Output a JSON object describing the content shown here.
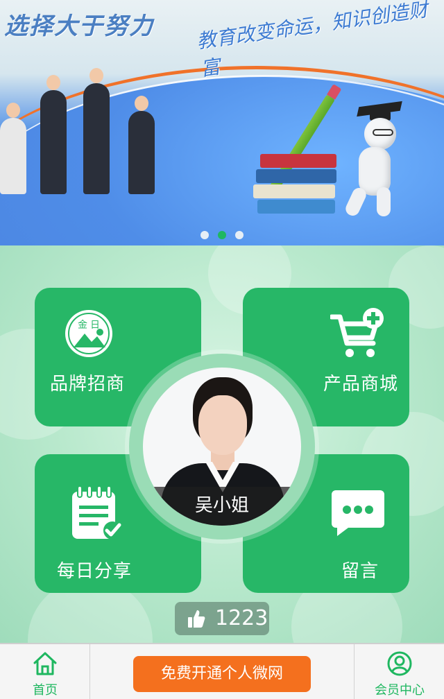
{
  "banner": {
    "title": "选择大于努力",
    "slogan": "教育改变命运，知识创造财富",
    "carousel": {
      "count": 3,
      "active_index": 1
    }
  },
  "tiles": {
    "brand": {
      "label": "品牌招商",
      "icon": "jinri-logo-icon"
    },
    "shop": {
      "label": "产品商城",
      "icon": "cart-add-icon"
    },
    "share": {
      "label": "每日分享",
      "icon": "notepad-check-icon"
    },
    "message": {
      "label": "留言",
      "icon": "chat-bubble-icon"
    }
  },
  "profile": {
    "name": "吴小姐"
  },
  "likes": {
    "count": "1223",
    "icon": "thumbs-up-icon"
  },
  "footer": {
    "home_label": "首页",
    "home_icon": "home-icon",
    "cta_label": "免费开通个人微网",
    "member_label": "会员中心",
    "member_icon": "user-icon"
  },
  "colors": {
    "primary_green": "#27b767",
    "cta_orange": "#f4701e",
    "active_dot": "#1fb760"
  }
}
